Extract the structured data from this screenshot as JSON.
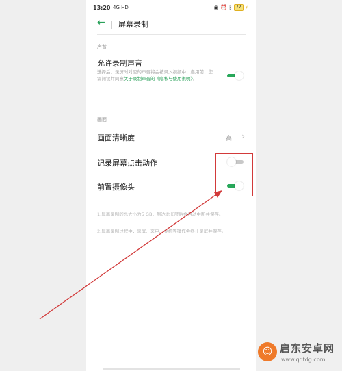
{
  "status_bar": {
    "time": "13:20",
    "network": "4G HD",
    "battery": "72"
  },
  "header": {
    "back_icon": "arrow-left-icon",
    "title": "屏幕录制"
  },
  "sections": {
    "sound_label": "声音",
    "picture_label": "画面"
  },
  "allow_sound": {
    "title": "允许录制声音",
    "desc_before_link": "选择后，录屏时对应的声音将会被录入视频中，启用前，您需阅读并同意",
    "link_text": "关于录制声音的《隐私与使用说明》",
    "desc_after_link": "。",
    "enabled": true
  },
  "picture_quality": {
    "title": "画面清晰度",
    "value": "高"
  },
  "record_taps": {
    "title": "记录屏幕点击动作",
    "enabled": false
  },
  "front_camera": {
    "title": "前置摄像头",
    "enabled": true
  },
  "notes": {
    "line1": "1.屏幕录制的总大小为5 GB，到达此长度后会自动中断并保存。",
    "line2": "2.屏幕录制过程中，息屏、来电、关机等操作会终止录屏并保存。"
  },
  "watermark": {
    "title": "启东安卓网",
    "url": "www.qdtdg.com"
  },
  "colors": {
    "accent": "#2aa15a",
    "annotation": "#d23a3a"
  }
}
